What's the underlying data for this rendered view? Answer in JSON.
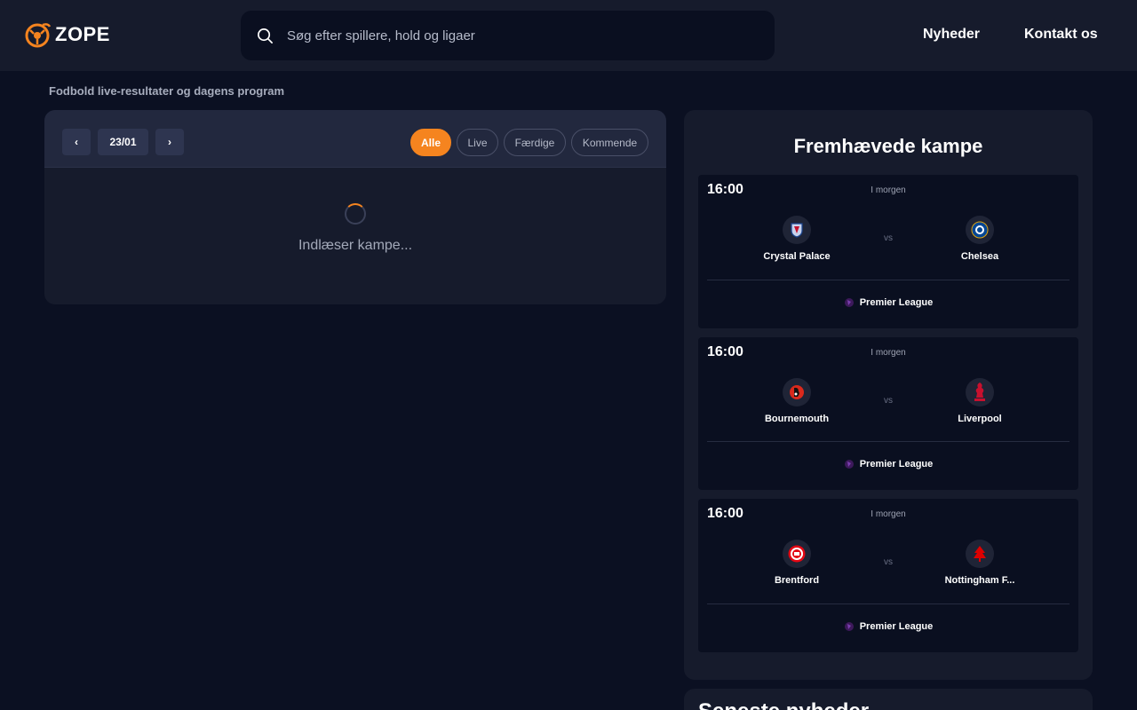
{
  "header": {
    "logo_text": "ZOPE",
    "search_placeholder": "Søg efter spillere, hold og ligaer",
    "nav": [
      "Nyheder",
      "Kontakt os"
    ]
  },
  "page": {
    "subtitle": "Fodbold live-resultater og dagens program"
  },
  "fixtures": {
    "prev_label": "‹",
    "date": "23/01",
    "next_label": "›",
    "filters": [
      "Alle",
      "Live",
      "Færdige",
      "Kommende"
    ],
    "active_filter": "Alle",
    "loading_text": "Indlæser kampe..."
  },
  "featured": {
    "title": "Fremhævede kampe",
    "vs_label": "vs",
    "matches": [
      {
        "time": "16:00",
        "day": "I morgen",
        "home": "Crystal Palace",
        "away": "Chelsea",
        "home_icon": "crystal-palace-crest-icon",
        "away_icon": "chelsea-crest-icon",
        "league": "Premier League"
      },
      {
        "time": "16:00",
        "day": "I morgen",
        "home": "Bournemouth",
        "away": "Liverpool",
        "home_icon": "bournemouth-crest-icon",
        "away_icon": "liverpool-crest-icon",
        "league": "Premier League"
      },
      {
        "time": "16:00",
        "day": "I morgen",
        "home": "Brentford",
        "away": "Nottingham F...",
        "home_icon": "brentford-crest-icon",
        "away_icon": "nottingham-forest-crest-icon",
        "league": "Premier League"
      }
    ]
  },
  "news": {
    "title": "Seneste nyheder"
  },
  "colors": {
    "accent": "#f5841f",
    "background": "#0b1022",
    "panel": "#161b2c",
    "card": "#0a0f20"
  }
}
